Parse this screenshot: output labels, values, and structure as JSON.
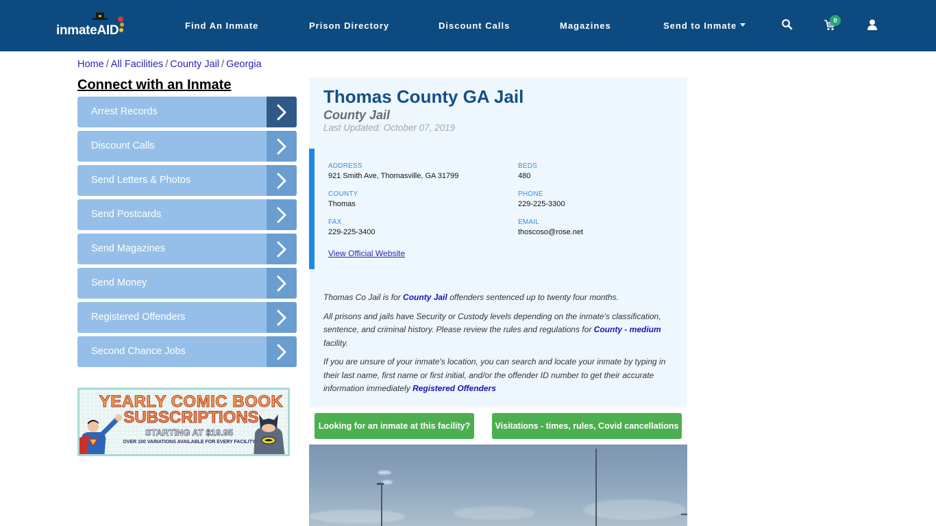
{
  "navbar": {
    "logo_text": "inmate",
    "logo_accent": "AID",
    "links": [
      {
        "label": "Find An Inmate"
      },
      {
        "label": "Prison Directory"
      },
      {
        "label": "Discount Calls"
      },
      {
        "label": "Magazines"
      },
      {
        "label": "Send to Inmate"
      }
    ],
    "cart_count": "0",
    "icons": [
      "search-icon",
      "cart-icon",
      "user-icon"
    ]
  },
  "breadcrumb": [
    {
      "label": "Home"
    },
    {
      "label": "All Facilities"
    },
    {
      "label": "County Jail"
    },
    {
      "label": "Georgia"
    }
  ],
  "breadcrumb_separator": "/",
  "sidebar": {
    "title": "Connect with an Inmate",
    "items": [
      {
        "label": "Arrest Records"
      },
      {
        "label": "Discount Calls"
      },
      {
        "label": "Send Letters & Photos"
      },
      {
        "label": "Send Postcards"
      },
      {
        "label": "Send Magazines"
      },
      {
        "label": "Send Money"
      },
      {
        "label": "Registered Offenders"
      },
      {
        "label": "Second Chance Jobs"
      }
    ],
    "ad": {
      "line1": "YEARLY COMIC BOOK",
      "line2": "SUBSCRIPTIONS",
      "line3": "STARTING AT $19.95",
      "line4": "OVER 100 VARIATIONS AVAILABLE FOR EVERY FACILITY"
    }
  },
  "facility": {
    "title": "Thomas County GA Jail",
    "type": "County Jail",
    "last_updated": "Last Updated: October 07, 2019",
    "fields": {
      "address": {
        "label": "ADDRESS",
        "value": "921 Smith Ave, Thomasville, GA 31799"
      },
      "beds": {
        "label": "BEDS",
        "value": "480"
      },
      "county": {
        "label": "COUNTY",
        "value": "Thomas"
      },
      "phone": {
        "label": "PHONE",
        "value": "229-225-3300"
      },
      "fax": {
        "label": "FAX",
        "value": "229-225-3400"
      },
      "email": {
        "label": "EMAIL",
        "value": "thoscoso@rose.net"
      }
    },
    "website_link": "View Official Website",
    "description": {
      "p1_pre": "Thomas Co Jail is for ",
      "p1_link": "County Jail",
      "p1_post": " offenders sentenced up to twenty four months.",
      "p2_pre": "All prisons and jails have Security or Custody levels depending on the inmate's classification, sentence, and criminal history. Please review the rules and regulations for ",
      "p2_link": "County - medium",
      "p2_post": " facility.",
      "p3_pre": "If you are unsure of your inmate's location, you can search and locate your inmate by typing in their last name, first name or first initial, and/or the offender ID number to get their accurate information immediately ",
      "p3_link": "Registered Offenders"
    }
  },
  "buttons": {
    "find_inmate": "Looking for an inmate at this facility?",
    "visitations": "Visitations - times, rules, Covid cancellations"
  },
  "colors": {
    "navbar": "#0d4a7f",
    "title": "#134f85",
    "accent": "#1e88e5",
    "sidebar_item": "#95bfe8",
    "sidebar_arrow": "#6a9ed1",
    "sidebar_arrow_active": "#2f5a87",
    "green_button": "#4caf50",
    "cart_badge": "#25a676"
  }
}
